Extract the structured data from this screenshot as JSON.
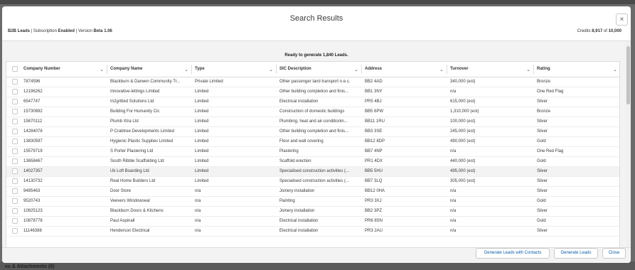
{
  "modal": {
    "title": "Search Results",
    "close_icon": "close-icon",
    "subtitle": {
      "prefix": "B2B Leads",
      "sep1": " | Subscription ",
      "subscription": "Enabled",
      "sep2": " | Version ",
      "version": "Beta 1.06"
    },
    "credits": {
      "label": "Credits ",
      "used": "8,917",
      "of": " of ",
      "total": "10,000"
    },
    "ready_text": "Ready to generate 1,840 Leads."
  },
  "table": {
    "columns": [
      "Company Number",
      "Company Name",
      "Type",
      "SIC Description",
      "Address",
      "Turnover",
      "Rating"
    ],
    "rows": [
      [
        "7874596",
        "Blackburn & Darwen Community Tr...",
        "Private Limited",
        "Other passenger land transport n.e.c.",
        "BB2 4AD",
        "340,000 (est)",
        "Bronze"
      ],
      [
        "12196262",
        "Innovative-lettings Limited",
        "Limited",
        "Other building completion and finis...",
        "BB1 3NY",
        "n/a",
        "One Red Flag"
      ],
      [
        "6547747",
        "In2gritted Solutions Ltd",
        "Limited",
        "Electrical installation",
        "PR5 4BJ",
        "615,000 (est)",
        "Silver"
      ],
      [
        "15730892",
        "Building For Humanity Cic",
        "Limited",
        "Construction of domestic buildings",
        "BB5 6PW",
        "1,310,000 (est)",
        "Bronze"
      ],
      [
        "15870112",
        "Plumb Xtra Ltd",
        "Limited",
        "Plumbing, heat and air-conditionin...",
        "BB11 1RU",
        "100,000 (est)",
        "Silver"
      ],
      [
        "14284078",
        "P Crabtree Developments Limited",
        "Limited",
        "Other building completion and finis...",
        "BB3 3SE",
        "245,000 (est)",
        "Silver"
      ],
      [
        "13830597",
        "Hygienic Plastic Supplies Limited",
        "Limited",
        "Floor and wall covering",
        "BB12 8DP",
        "490,000 (est)",
        "Gold"
      ],
      [
        "15579719",
        "S Porter Plastering Ltd",
        "Limited",
        "Plastering",
        "BB7 4NP",
        "n/a",
        "One Red Flag"
      ],
      [
        "13658467",
        "South Ribble Scaffolding Ltd",
        "Limited",
        "Scaffold erection",
        "PR1 4DX",
        "440,000 (est)",
        "Gold"
      ],
      [
        "14027357",
        "Uk Loft Boarding Ltd",
        "Limited",
        "Specialised construction activities (...",
        "BB5 5HU",
        "495,000 (est)",
        "Silver"
      ],
      [
        "14130732",
        "Real Home Builders Ltd",
        "Limited",
        "Specialised construction activities (...",
        "BB7 3LQ",
        "305,000 (est)",
        "Silver"
      ],
      [
        "9485463",
        "Door Store",
        "n/a",
        "Joinery installation",
        "BB12 0HA",
        "n/a",
        "Silver"
      ],
      [
        "9520743",
        "Veevers Windowseal",
        "n/a",
        "Painting",
        "PR3 3XJ",
        "n/a",
        "Gold"
      ],
      [
        "10825123",
        "Blackburn Doors & Kitchens",
        "n/a",
        "Joinery installation",
        "BB2 3PZ",
        "n/a",
        "Silver"
      ],
      [
        "10878778",
        "Paul Aspinall",
        "n/a",
        "Electrical installation",
        "PR6 8SN",
        "n/a",
        "Gold"
      ],
      [
        "11146388",
        "Henderson Electrical",
        "n/a",
        "Electrical installation",
        "PR3 2AU",
        "n/a",
        "Silver"
      ]
    ]
  },
  "footer": {
    "generate_with_contacts": "Generate Leads with Contacts",
    "generate": "Generate Leads",
    "close": "Close"
  },
  "background": {
    "partial_text": "es & Attachments (0)"
  }
}
